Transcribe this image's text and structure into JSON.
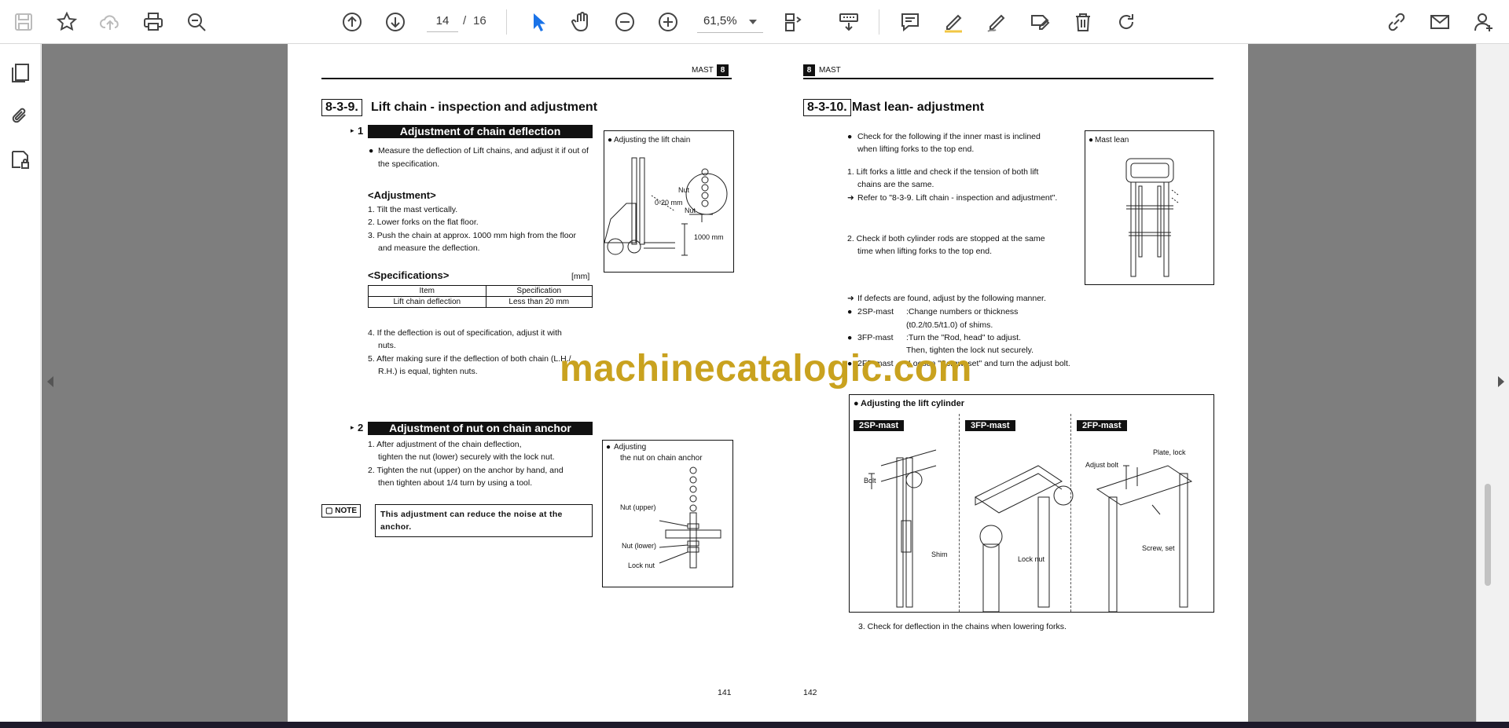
{
  "toolbar": {
    "icons": [
      "save-icon",
      "bookmark-star-icon",
      "upload-cloud-icon",
      "print-icon",
      "zoom-search-icon",
      "page-up-icon",
      "page-down-icon",
      "select-arrow-icon",
      "pan-hand-icon",
      "zoom-out-icon",
      "zoom-in-icon",
      "fit-page-icon",
      "scroll-mode-icon",
      "comment-icon",
      "highlight-pen-icon",
      "draw-icon",
      "stamp-icon",
      "delete-icon",
      "redo-icon",
      "share-link-icon",
      "email-icon",
      "add-user-icon"
    ],
    "page_current": "14",
    "page_sep": "/",
    "page_total": "16",
    "zoom": "61,5%"
  },
  "sidebar": {
    "icons": [
      "pages-panel-icon",
      "attachments-icon",
      "document-properties-icon"
    ]
  },
  "left_page": {
    "header": "MAST",
    "header_num": "8",
    "section_num": "8-3-9.",
    "section_title": "Lift chain - inspection and adjustment",
    "sub1_num": "1",
    "sub1_title": "Adjustment of chain deflection",
    "sub1_bullet": "Measure the deflection of Lift chains, and adjust it if out of the specification.",
    "adj_heading": "<Adjustment>",
    "adj_steps": [
      "1. Tilt the mast vertically.",
      "2. Lower forks on the flat floor.",
      "3. Push the chain at approx. 1000 mm high from the floor",
      "and measure the deflection."
    ],
    "spec_heading": "<Specifications>",
    "spec_unit": "[mm]",
    "spec_cols": [
      "Item",
      "Specification"
    ],
    "spec_row": [
      "Lift chain deflection",
      "Less than 20 mm"
    ],
    "steps_after": [
      "4. If the deflection is out of specification, adjust it with",
      "nuts.",
      "5. After making sure if the deflection of both chain (L.H./",
      "R.H.) is equal, tighten nuts."
    ],
    "fig1_caption": "Adjusting the lift chain",
    "fig1_labels": [
      "Nut",
      "0-20 mm",
      "Nut",
      "1000 mm"
    ],
    "sub2_num": "2",
    "sub2_title": "Adjustment of nut on chain anchor",
    "sub2_steps": [
      "1. After adjustment of the chain deflection,",
      "tighten the nut (lower) securely with the lock nut.",
      "2. Tighten the nut (upper) on the anchor by hand, and",
      "then tighten about 1/4 turn by using a tool."
    ],
    "note_tag": "NOTE",
    "note_text": "This adjustment can reduce the noise at the anchor.",
    "fig2_caption": [
      "Adjusting",
      "the nut on chain anchor"
    ],
    "fig2_labels": [
      "Nut (upper)",
      "Nut (lower)",
      "Lock nut"
    ],
    "page_number": "141"
  },
  "right_page": {
    "header": "MAST",
    "header_num": "8",
    "section_num": "8-3-10.",
    "section_title": "Mast lean- adjustment",
    "bullet1": [
      "Check for the following if the inner mast is inclined",
      "when lifting forks to the top end."
    ],
    "step1": [
      "1. Lift forks a little and check if the tension of both lift",
      "chains are the same."
    ],
    "ref1": "Refer to \"8-3-9. Lift chain - inspection and adjustment\".",
    "step2": [
      "2. Check if both cylinder rods are stopped at the same",
      "time when lifting forks to the top end."
    ],
    "defect_line": "If defects are found, adjust by the following manner.",
    "items": [
      {
        "label": "2SP-mast",
        "text": [
          ":Change numbers or thickness",
          "(t0.2/t0.5/t1.0) of shims."
        ]
      },
      {
        "label": "3FP-mast",
        "text": [
          ":Turn the \"Rod, head\" to adjust.",
          "Then, tighten the lock nut securely."
        ]
      },
      {
        "label": "2FP-mast",
        "text": [
          ":Loosen \"Screw, set\" and turn the adjust bolt."
        ]
      }
    ],
    "fig_mast_caption": "Mast lean",
    "fig_cyl_caption": "Adjusting the lift cylinder",
    "fig_cyl_heads": [
      "2SP-mast",
      "3FP-mast",
      "2FP-mast"
    ],
    "fig_cyl_labels": [
      "Bolt",
      "Shim",
      "Lock nut",
      "Plate, lock",
      "Adjust bolt",
      "Screw, set"
    ],
    "step3": "3. Check for deflection in the chains when lowering forks.",
    "page_number": "142"
  },
  "watermark": "machinecatalogic.com"
}
